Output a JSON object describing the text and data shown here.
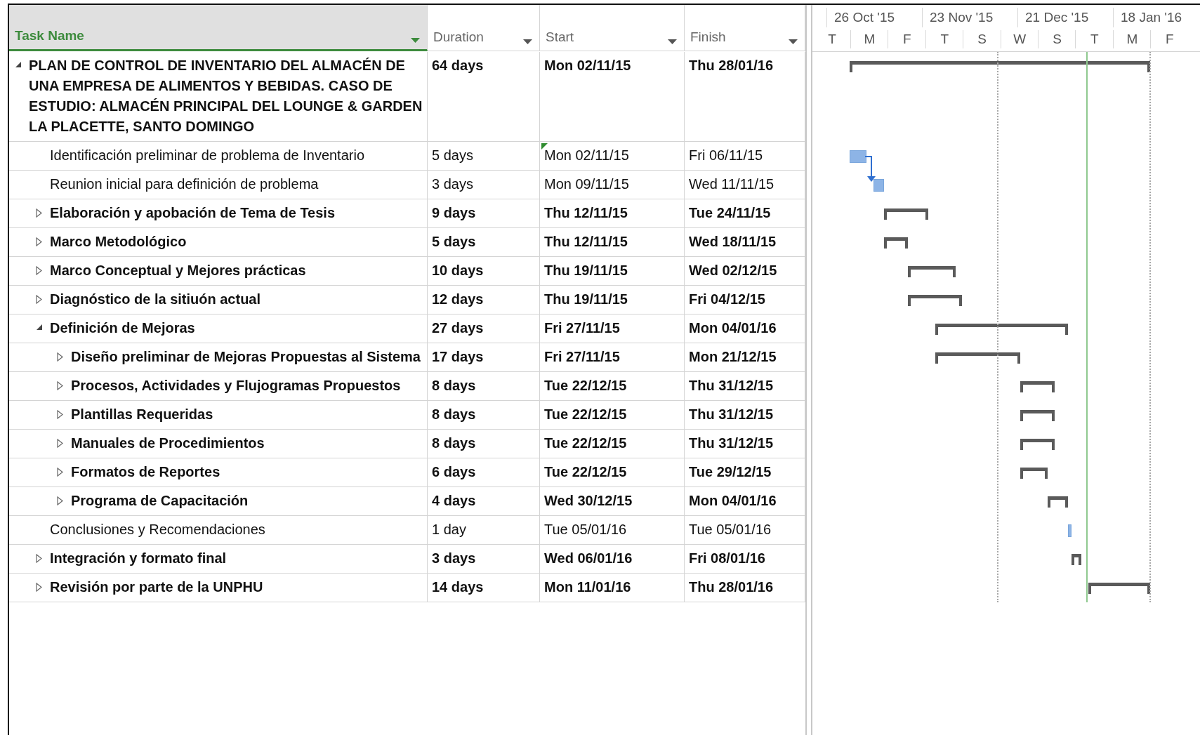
{
  "columns": [
    {
      "label": "Task Name",
      "selected": true
    },
    {
      "label": "Duration",
      "selected": false
    },
    {
      "label": "Start",
      "selected": false
    },
    {
      "label": "Finish",
      "selected": false
    }
  ],
  "timescale": {
    "major": [
      "26 Oct '15",
      "23 Nov '15",
      "21 Dec '15",
      "18 Jan '16"
    ],
    "minor": [
      "T",
      "M",
      "F",
      "T",
      "S",
      "W",
      "S",
      "T",
      "M",
      "F"
    ]
  },
  "tasks": [
    {
      "kind": "summary",
      "name": "PLAN DE CONTROL DE INVENTARIO DEL ALMACÉN DE UNA EMPRESA DE ALIMENTOS Y BEBIDAS. CASO DE ESTUDIO: ALMACÉN PRINCIPAL DEL LOUNGE & GARDEN LA PLACETTE, SANTO DOMINGO",
      "duration": "64 days",
      "start": "Mon 02/11/15",
      "finish": "Thu 28/01/16",
      "expanded": true,
      "edited": false,
      "linked": false,
      "children": [
        {
          "kind": "task",
          "name": "Identificación preliminar de problema de Inventario",
          "duration": "5 days",
          "start": "Mon 02/11/15",
          "finish": "Fri 06/11/15",
          "edited": true,
          "linked": true
        },
        {
          "kind": "task",
          "name": "Reunion inicial para definición de problema",
          "duration": "3 days",
          "start": "Mon 09/11/15",
          "finish": "Wed 11/11/15",
          "edited": false,
          "linked": false
        },
        {
          "kind": "summary",
          "name": "Elaboración y apobación de Tema de Tesis",
          "duration": "9 days",
          "start": "Thu 12/11/15",
          "finish": "Tue 24/11/15",
          "expanded": false,
          "edited": false,
          "linked": false
        },
        {
          "kind": "summary",
          "name": "Marco Metodológico",
          "duration": "5 days",
          "start": "Thu 12/11/15",
          "finish": "Wed 18/11/15",
          "expanded": false,
          "edited": false,
          "linked": false
        },
        {
          "kind": "summary",
          "name": "Marco Conceptual y Mejores prácticas",
          "duration": "10 days",
          "start": "Thu 19/11/15",
          "finish": "Wed 02/12/15",
          "expanded": false,
          "edited": false,
          "linked": false
        },
        {
          "kind": "summary",
          "name": "Diagnóstico de la sitiuón actual",
          "duration": "12 days",
          "start": "Thu 19/11/15",
          "finish": "Fri 04/12/15",
          "expanded": false,
          "edited": false,
          "linked": false
        },
        {
          "kind": "summary",
          "name": "Definición de Mejoras",
          "duration": "27 days",
          "start": "Fri 27/11/15",
          "finish": "Mon 04/01/16",
          "expanded": true,
          "edited": false,
          "linked": false,
          "children": [
            {
              "kind": "summary",
              "name": "Diseño preliminar de Mejoras Propuestas al Sistema",
              "duration": "17 days",
              "start": "Fri 27/11/15",
              "finish": "Mon 21/12/15",
              "expanded": false,
              "edited": false,
              "linked": false
            },
            {
              "kind": "summary",
              "name": "Procesos, Actividades y Flujogramas Propuestos",
              "duration": "8 days",
              "start": "Tue 22/12/15",
              "finish": "Thu 31/12/15",
              "expanded": false,
              "edited": false,
              "linked": false
            },
            {
              "kind": "summary",
              "name": "Plantillas Requeridas",
              "duration": "8 days",
              "start": "Tue 22/12/15",
              "finish": "Thu 31/12/15",
              "expanded": false,
              "edited": false,
              "linked": false
            },
            {
              "kind": "summary",
              "name": "Manuales de Procedimientos",
              "duration": "8 days",
              "start": "Tue 22/12/15",
              "finish": "Thu 31/12/15",
              "expanded": false,
              "edited": false,
              "linked": false
            },
            {
              "kind": "summary",
              "name": "Formatos de Reportes",
              "duration": "6 days",
              "start": "Tue 22/12/15",
              "finish": "Tue 29/12/15",
              "expanded": false,
              "edited": false,
              "linked": false
            },
            {
              "kind": "summary",
              "name": "Programa de Capacitación",
              "duration": "4 days",
              "start": "Wed 30/12/15",
              "finish": "Mon 04/01/16",
              "expanded": false,
              "edited": false,
              "linked": false
            }
          ]
        },
        {
          "kind": "task",
          "name": "Conclusiones y Recomendaciones",
          "duration": "1 day",
          "start": "Tue 05/01/16",
          "finish": "Tue 05/01/16",
          "edited": false,
          "linked": false
        },
        {
          "kind": "summary",
          "name": "Integración y formato final",
          "duration": "3 days",
          "start": "Wed 06/01/16",
          "finish": "Fri 08/01/16",
          "expanded": false,
          "edited": false,
          "linked": false
        },
        {
          "kind": "summary",
          "name": "Revisión por parte de la UNPHU",
          "duration": "14 days",
          "start": "Mon 11/01/16",
          "finish": "Thu 28/01/16",
          "expanded": false,
          "edited": false,
          "linked": false
        }
      ]
    }
  ]
}
